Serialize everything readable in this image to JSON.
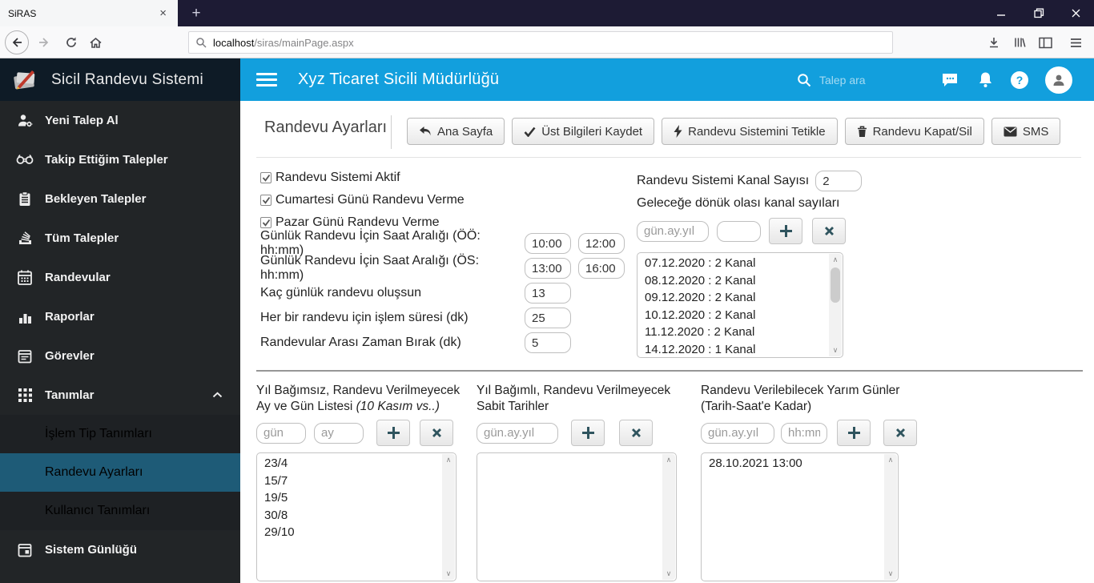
{
  "browser": {
    "tab_title": "SiRAS",
    "url_host": "localhost",
    "url_path": "/siras/mainPage.aspx"
  },
  "icons": {
    "tab_close": "×",
    "new_tab": "+",
    "minimize": "—",
    "close": "×",
    "help_glyph": "?",
    "scroll_up": "∧",
    "scroll_down": "∨"
  },
  "header": {
    "brand": "Sicil Randevu Sistemi",
    "title": "Xyz Ticaret Sicili Müdürlüğü",
    "search_placeholder": "Talep ara"
  },
  "sidebar": {
    "items": [
      {
        "label": "Yeni Talep Al",
        "icon": "person-gear-icon"
      },
      {
        "label": "Takip Ettiğim Talepler",
        "icon": "binoculars-icon"
      },
      {
        "label": "Bekleyen Talepler",
        "icon": "clipboard-icon"
      },
      {
        "label": "Tüm Talepler",
        "icon": "stack-icon"
      },
      {
        "label": "Randevular",
        "icon": "calendar-icon"
      },
      {
        "label": "Raporlar",
        "icon": "bar-chart-icon"
      },
      {
        "label": "Görevler",
        "icon": "task-calendar-icon"
      },
      {
        "label": "Tanımlar",
        "icon": "grid-icon"
      }
    ],
    "submenu": [
      {
        "label": "İşlem Tip Tanımları",
        "active": false
      },
      {
        "label": "Randevu Ayarları",
        "active": true
      },
      {
        "label": "Kullanıcı Tanımları",
        "active": false
      }
    ],
    "footer_item": {
      "label": "Sistem Günlüğü",
      "icon": "log-calendar-icon"
    }
  },
  "page": {
    "title": "Randevu Ayarları",
    "toolbar": {
      "home": "Ana Sayfa",
      "save": "Üst Bilgileri Kaydet",
      "trigger": "Randevu Sistemini Tetikle",
      "delete": "Randevu Kapat/Sil",
      "sms": "SMS"
    },
    "checkboxes": [
      {
        "label": "Randevu Sistemi Aktif",
        "checked": true
      },
      {
        "label": "Cumartesi Günü Randevu Verme",
        "checked": true
      },
      {
        "label": "Pazar Günü Randevu Verme",
        "checked": true
      }
    ],
    "rows": [
      {
        "label": "Günlük Randevu İçin Saat Aralığı (ÖÖ: hh:mm)",
        "v1": "10:00",
        "v2": "12:00"
      },
      {
        "label": "Günlük Randevu İçin Saat Aralığı (ÖS: hh:mm)",
        "v1": "13:00",
        "v2": "16:00"
      },
      {
        "label": "Kaç günlük randevu oluşsun",
        "v1": "13"
      },
      {
        "label": "Her bir randevu için işlem süresi (dk)",
        "v1": "25"
      },
      {
        "label": "Randevular Arası Zaman Bırak (dk)",
        "v1": "5"
      }
    ],
    "channel": {
      "label": "Randevu Sistemi Kanal Sayısı",
      "value": "2",
      "sub_label": "Geleceğe dönük olası kanal sayıları",
      "date_placeholder": "gün.ay.yıl",
      "list": [
        "07.12.2020 : 2 Kanal",
        "08.12.2020 : 2 Kanal",
        "09.12.2020 : 2 Kanal",
        "10.12.2020 : 2 Kanal",
        "11.12.2020 : 2 Kanal",
        "14.12.2020 : 1 Kanal"
      ]
    },
    "col1": {
      "title": "Yıl Bağımsız, Randevu Verilmeyecek Ay ve Gün Listesi ",
      "title_italic": "(10 Kasım vs..)",
      "p1": "gün",
      "p2": "ay",
      "list": [
        "23/4",
        "15/7",
        "19/5",
        "30/8",
        "29/10"
      ]
    },
    "col2": {
      "title": "Yıl Bağımlı, Randevu Verilmeyecek Sabit Tarihler",
      "p1": "gün.ay.yıl",
      "list": []
    },
    "col3": {
      "title": "Randevu Verilebilecek Yarım Günler (Tarih-Saat'e Kadar)",
      "p1": "gün.ay.yıl",
      "p2": "hh:mm",
      "list": [
        "28.10.2021 13:00"
      ]
    }
  },
  "colors": {
    "header_blue": "#129fdd",
    "sidebar_dark": "#222527",
    "logo_dark": "#0e1b26",
    "active_teal": "#1e5b77",
    "titlebar_dark": "#1d1b34",
    "glyph_teal": "#2f545e"
  }
}
